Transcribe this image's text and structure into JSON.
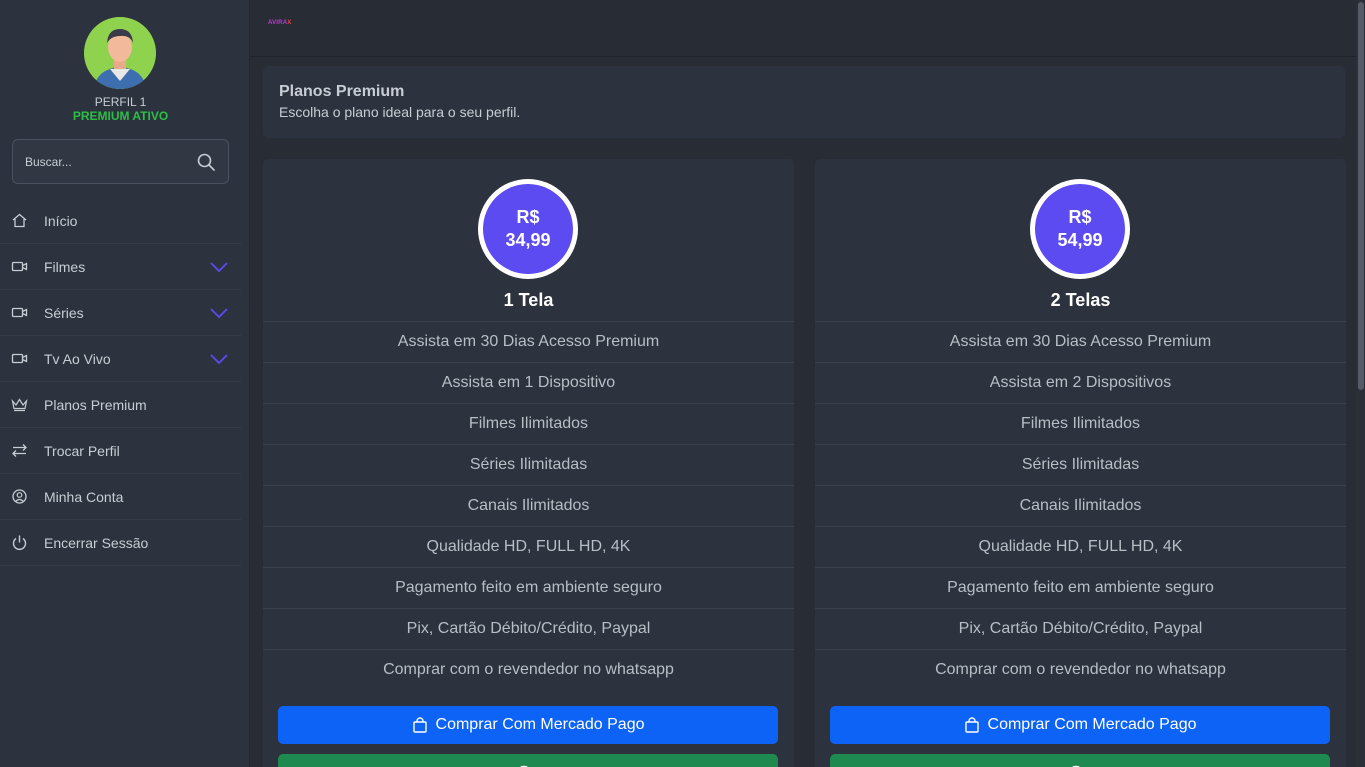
{
  "profile": {
    "name": "PERFIL 1",
    "status": "PREMIUM ATIVO"
  },
  "search": {
    "placeholder": "Buscar..."
  },
  "nav": [
    {
      "label": "Início",
      "icon": "home-icon",
      "has_chevron": false
    },
    {
      "label": "Filmes",
      "icon": "video-icon",
      "has_chevron": true
    },
    {
      "label": "Séries",
      "icon": "video-icon",
      "has_chevron": true
    },
    {
      "label": "Tv Ao Vivo",
      "icon": "video-icon",
      "has_chevron": true
    },
    {
      "label": "Planos Premium",
      "icon": "crown-icon",
      "has_chevron": false
    },
    {
      "label": "Trocar Perfil",
      "icon": "swap-icon",
      "has_chevron": false
    },
    {
      "label": "Minha Conta",
      "icon": "user-circle-icon",
      "has_chevron": false
    },
    {
      "label": "Encerrar Sessão",
      "icon": "power-icon",
      "has_chevron": false
    }
  ],
  "logo": {
    "text_a": "AVIRA",
    "text_b": "X"
  },
  "header": {
    "title": "Planos Premium",
    "subtitle": "Escolha o plano ideal para o seu perfil."
  },
  "plans": [
    {
      "currency": "R$",
      "price": "34,99",
      "name": "1 Tela",
      "features": [
        "Assista em 30 Dias Acesso Premium",
        "Assista em 1 Dispositivo",
        "Filmes Ilimitados",
        "Séries Ilimitadas",
        "Canais Ilimitados",
        "Qualidade HD, FULL HD, 4K",
        "Pagamento feito em ambiente seguro",
        "Pix, Cartão Débito/Crédito, Paypal",
        "Comprar com o revendedor no whatsapp"
      ],
      "buy_mp": "Comprar Com Mercado Pago"
    },
    {
      "currency": "R$",
      "price": "54,99",
      "name": "2 Telas",
      "features": [
        "Assista em 30 Dias Acesso Premium",
        "Assista em 2 Dispositivos",
        "Filmes Ilimitados",
        "Séries Ilimitadas",
        "Canais Ilimitados",
        "Qualidade HD, FULL HD, 4K",
        "Pagamento feito em ambiente seguro",
        "Pix, Cartão Débito/Crédito, Paypal",
        "Comprar com o revendedor no whatsapp"
      ],
      "buy_mp": "Comprar Com Mercado Pago"
    }
  ],
  "colors": {
    "accent": "#5b4bf0",
    "premium_green": "#2bbf45",
    "mercado_pago_button": "#0d63f5",
    "whatsapp_button": "#1f8a4f"
  }
}
